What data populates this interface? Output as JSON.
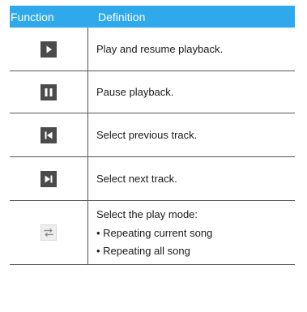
{
  "header": {
    "function_label": "Function",
    "definition_label": "Definition",
    "background": "#2fa9ec"
  },
  "rows": [
    {
      "icon": "play-icon",
      "definition": "Play and resume playback."
    },
    {
      "icon": "pause-icon",
      "definition": "Pause playback."
    },
    {
      "icon": "previous-track-icon",
      "definition": "Select previous track."
    },
    {
      "icon": "next-track-icon",
      "definition": "Select next track."
    },
    {
      "icon": "repeat-icon",
      "definition": "Select the play mode:",
      "bullets": [
        "• Repeating current song",
        "• Repeating all song"
      ]
    }
  ]
}
